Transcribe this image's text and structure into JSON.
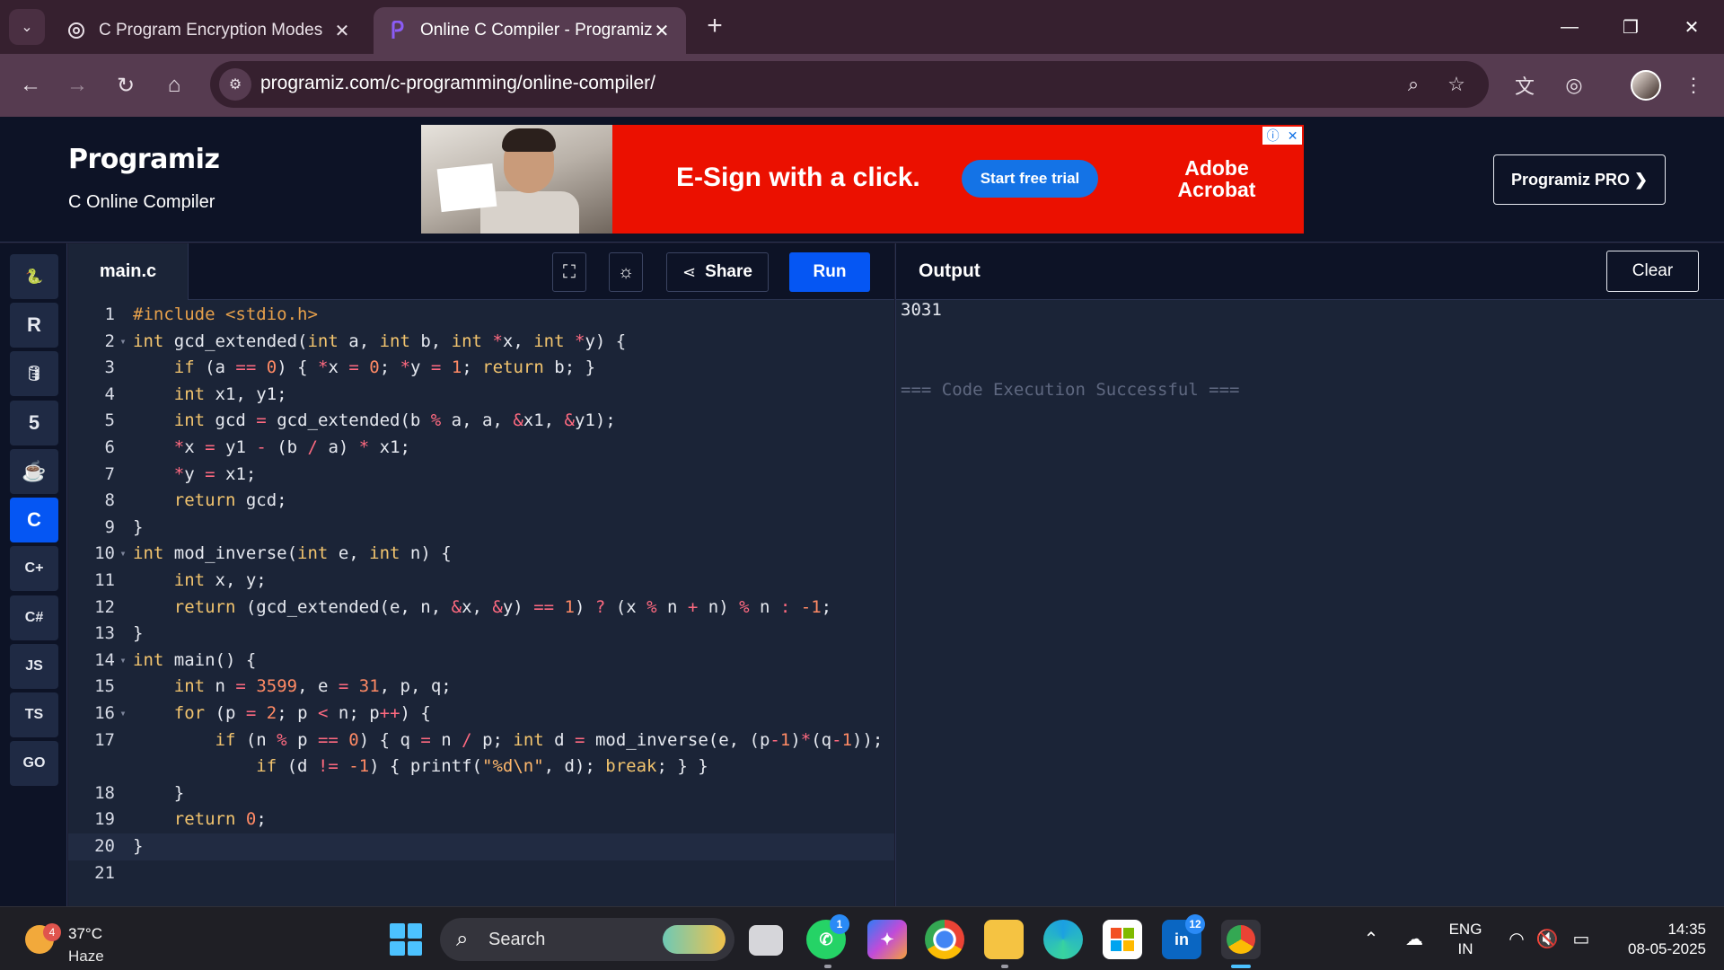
{
  "browser": {
    "tabs": [
      {
        "title": "C Program Encryption Modes",
        "active": false
      },
      {
        "title": "Online C Compiler - Programiz",
        "active": true
      }
    ],
    "url": "programiz.com/c-programming/online-compiler/"
  },
  "site": {
    "logo": "Programiz",
    "subtitle": "C Online Compiler",
    "pro_button": "Programiz PRO ❯"
  },
  "ad": {
    "headline": "E-Sign with a click.",
    "cta": "Start free trial",
    "brand_line1": "Adobe",
    "brand_line2": "Acrobat"
  },
  "sidebar": {
    "languages": [
      {
        "name": "python-icon",
        "glyph": "🐍",
        "active": false
      },
      {
        "name": "r-icon",
        "glyph": "R",
        "active": false
      },
      {
        "name": "sql-icon",
        "glyph": "🛢",
        "active": false
      },
      {
        "name": "html-icon",
        "glyph": "5",
        "active": false
      },
      {
        "name": "java-icon",
        "glyph": "☕",
        "active": false
      },
      {
        "name": "c-icon",
        "glyph": "C",
        "active": true
      },
      {
        "name": "cpp-icon",
        "glyph": "C+",
        "active": false
      },
      {
        "name": "csharp-icon",
        "glyph": "C#",
        "active": false
      },
      {
        "name": "js-icon",
        "glyph": "JS",
        "active": false
      },
      {
        "name": "ts-icon",
        "glyph": "TS",
        "active": false
      },
      {
        "name": "go-icon",
        "glyph": "GO",
        "active": false
      }
    ]
  },
  "editor": {
    "filename": "main.c",
    "share_label": "Share",
    "run_label": "Run",
    "lines": [
      {
        "n": "1",
        "fold": false,
        "html": "<span class='pp'>#include &lt;stdio.h&gt;</span>"
      },
      {
        "n": "2",
        "fold": true,
        "html": "<span class='kw'>int</span> gcd_extended(<span class='kw'>int</span> a, <span class='kw'>int</span> b, <span class='kw'>int</span> <span class='op'>*</span>x, <span class='kw'>int</span> <span class='op'>*</span>y) {"
      },
      {
        "n": "3",
        "fold": false,
        "html": "    <span class='kw'>if</span> (a <span class='op'>==</span> <span class='num'>0</span>) { <span class='op'>*</span>x <span class='op'>=</span> <span class='num'>0</span>; <span class='op'>*</span>y <span class='op'>=</span> <span class='num'>1</span>; <span class='kw'>return</span> b; }"
      },
      {
        "n": "4",
        "fold": false,
        "html": "    <span class='kw'>int</span> x1, y1;"
      },
      {
        "n": "5",
        "fold": false,
        "html": "    <span class='kw'>int</span> gcd <span class='op'>=</span> gcd_extended(b <span class='op'>%</span> a, a, <span class='op'>&amp;</span>x1, <span class='op'>&amp;</span>y1);"
      },
      {
        "n": "6",
        "fold": false,
        "html": "    <span class='op'>*</span>x <span class='op'>=</span> y1 <span class='op'>-</span> (b <span class='op'>/</span> a) <span class='op'>*</span> x1;"
      },
      {
        "n": "7",
        "fold": false,
        "html": "    <span class='op'>*</span>y <span class='op'>=</span> x1;"
      },
      {
        "n": "8",
        "fold": false,
        "html": "    <span class='kw'>return</span> gcd;"
      },
      {
        "n": "9",
        "fold": false,
        "html": "}"
      },
      {
        "n": "10",
        "fold": true,
        "html": "<span class='kw'>int</span> mod_inverse(<span class='kw'>int</span> e, <span class='kw'>int</span> n) {"
      },
      {
        "n": "11",
        "fold": false,
        "html": "    <span class='kw'>int</span> x, y;"
      },
      {
        "n": "12",
        "fold": false,
        "html": "    <span class='kw'>return</span> (gcd_extended(e, n, <span class='op'>&amp;</span>x, <span class='op'>&amp;</span>y) <span class='op'>==</span> <span class='num'>1</span>) <span class='op'>?</span> (x <span class='op'>%</span> n <span class='op'>+</span> n) <span class='op'>%</span> n <span class='op'>:</span> <span class='num'>-1</span>;"
      },
      {
        "n": "13",
        "fold": false,
        "html": "}"
      },
      {
        "n": "14",
        "fold": true,
        "html": "<span class='kw'>int</span> main() {"
      },
      {
        "n": "15",
        "fold": false,
        "html": "    <span class='kw'>int</span> n <span class='op'>=</span> <span class='num'>3599</span>, e <span class='op'>=</span> <span class='num'>31</span>, p, q;"
      },
      {
        "n": "16",
        "fold": true,
        "html": "    <span class='kw'>for</span> (p <span class='op'>=</span> <span class='num'>2</span>; p <span class='op'>&lt;</span> n; p<span class='op'>++</span>) {"
      },
      {
        "n": "17",
        "fold": false,
        "html": "        <span class='kw'>if</span> (n <span class='op'>%</span> p <span class='op'>==</span> <span class='num'>0</span>) { q <span class='op'>=</span> n <span class='op'>/</span> p; <span class='kw'>int</span> d <span class='op'>=</span> mod_inverse(e, (p<span class='op'>-</span><span class='num'>1</span>)<span class='op'>*</span>(q<span class='op'>-</span><span class='num'>1</span>));"
      },
      {
        "n": "",
        "fold": false,
        "html": "            <span class='kw'>if</span> (d <span class='op'>!=</span> <span class='num'>-1</span>) { printf(<span class='str'>\"%d\\n\"</span>, d); <span class='kw'>break</span>; } }"
      },
      {
        "n": "18",
        "fold": false,
        "html": "    }"
      },
      {
        "n": "19",
        "fold": false,
        "html": "    <span class='kw'>return</span> <span class='num'>0</span>;"
      },
      {
        "n": "20",
        "fold": false,
        "current": true,
        "html": "}"
      },
      {
        "n": "21",
        "fold": false,
        "html": ""
      }
    ]
  },
  "output": {
    "title": "Output",
    "clear_label": "Clear",
    "lines": [
      "3031",
      "",
      "",
      "=== Code Execution Successful ==="
    ]
  },
  "taskbar": {
    "weather_temp": "37°C",
    "weather_cond": "Haze",
    "weather_badge": "4",
    "search_placeholder": "Search",
    "whatsapp_badge": "1",
    "linkedin_badge": "12",
    "lang_line1": "ENG",
    "lang_line2": "IN",
    "time": "14:35",
    "date": "08-05-2025"
  }
}
